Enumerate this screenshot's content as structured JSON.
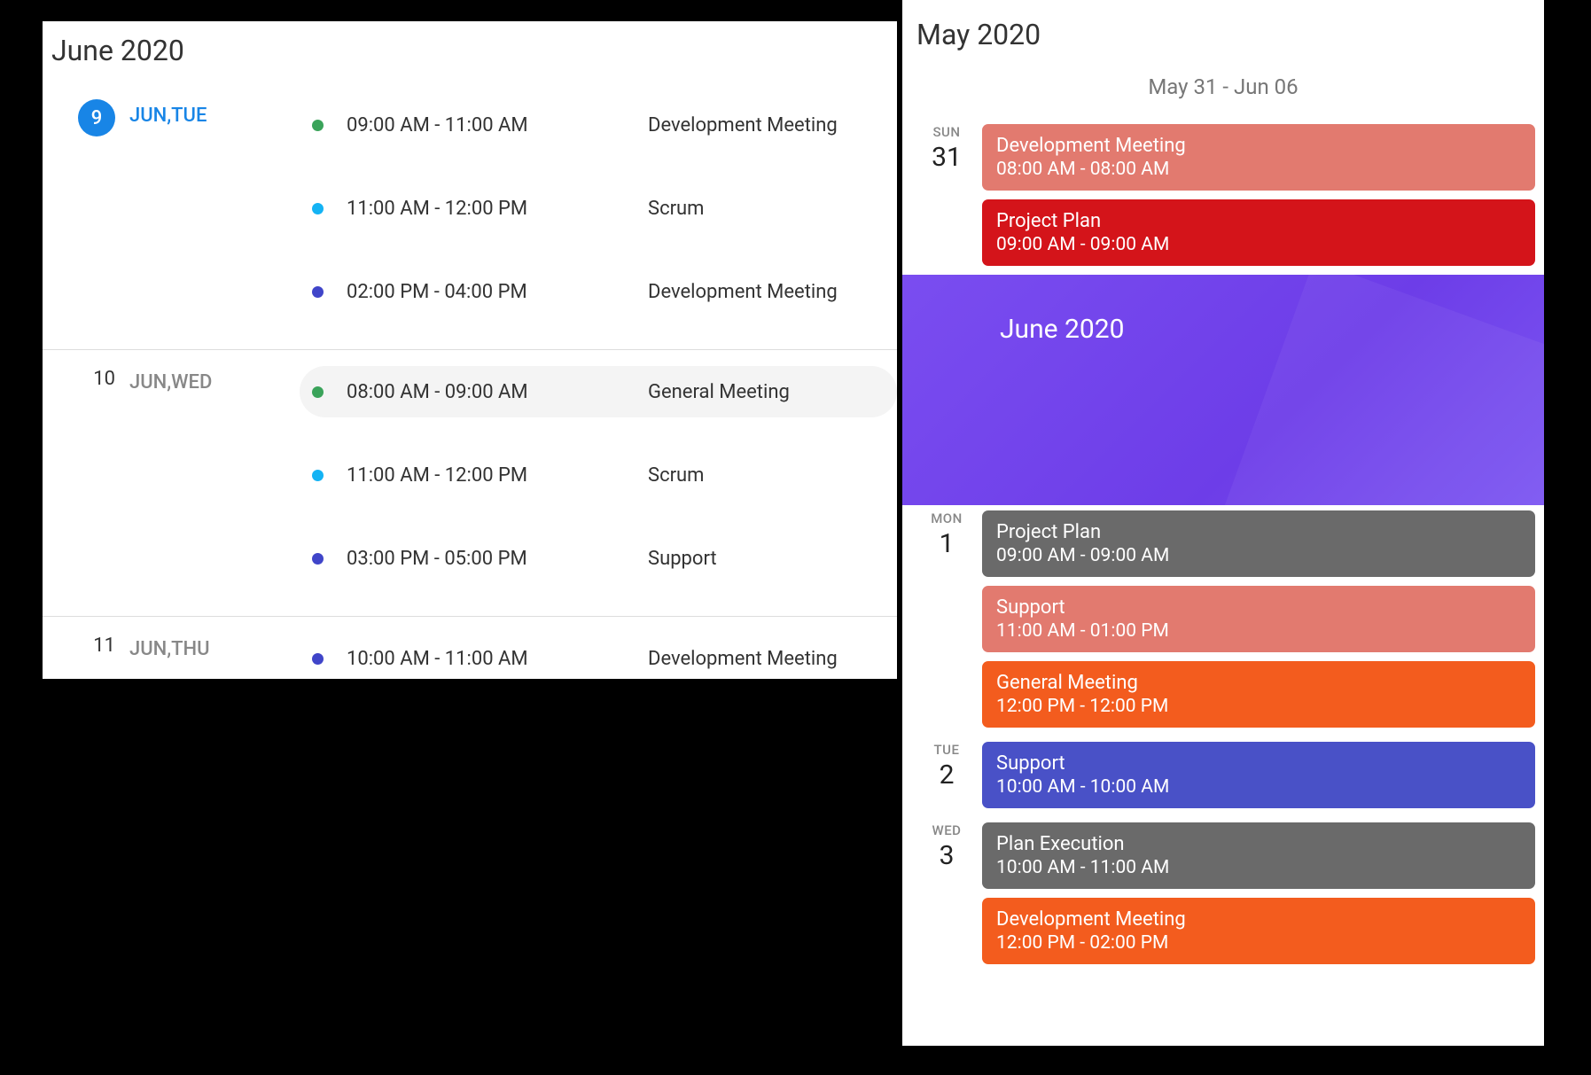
{
  "left": {
    "title": "June 2020",
    "days": [
      {
        "num": "9",
        "label": "JUN,TUE",
        "active": true,
        "events": [
          {
            "color": "#3aa35a",
            "time": "09:00 AM - 11:00 AM",
            "title": "Development Meeting",
            "highlight": false
          },
          {
            "color": "#14b3f4",
            "time": "11:00 AM - 12:00 PM",
            "title": "Scrum",
            "highlight": false
          },
          {
            "color": "#4045c9",
            "time": "02:00 PM - 04:00 PM",
            "title": "Development Meeting",
            "highlight": false
          }
        ]
      },
      {
        "num": "10",
        "label": "JUN,WED",
        "active": false,
        "events": [
          {
            "color": "#3aa35a",
            "time": "08:00 AM - 09:00 AM",
            "title": "General Meeting",
            "highlight": true
          },
          {
            "color": "#14b3f4",
            "time": "11:00 AM - 12:00 PM",
            "title": "Scrum",
            "highlight": false
          },
          {
            "color": "#4045c9",
            "time": "03:00 PM - 05:00 PM",
            "title": "Support",
            "highlight": false
          }
        ]
      },
      {
        "num": "11",
        "label": "JUN,THU",
        "active": false,
        "events": [
          {
            "color": "#4045c9",
            "time": "10:00 AM - 11:00 AM",
            "title": "Development Meeting",
            "highlight": false
          }
        ]
      }
    ]
  },
  "right": {
    "title": "May 2020",
    "week_range": "May 31 - Jun 06",
    "month_banner": "June 2020",
    "days_before": [
      {
        "dow": "SUN",
        "num": "31",
        "events": [
          {
            "bg": "#e27a6f",
            "title": "Development Meeting",
            "time": "08:00 AM - 08:00 AM"
          },
          {
            "bg": "#d4141a",
            "title": "Project Plan",
            "time": "09:00 AM - 09:00 AM"
          }
        ]
      }
    ],
    "days_after": [
      {
        "dow": "MON",
        "num": "1",
        "events": [
          {
            "bg": "#6a6a6a",
            "title": "Project Plan",
            "time": "09:00 AM - 09:00 AM"
          },
          {
            "bg": "#e27a6f",
            "title": "Support",
            "time": "11:00 AM - 01:00 PM"
          },
          {
            "bg": "#f35c1e",
            "title": "General Meeting",
            "time": "12:00 PM - 12:00 PM"
          }
        ]
      },
      {
        "dow": "TUE",
        "num": "2",
        "events": [
          {
            "bg": "#4951c7",
            "title": "Support",
            "time": "10:00 AM - 10:00 AM"
          }
        ]
      },
      {
        "dow": "WED",
        "num": "3",
        "events": [
          {
            "bg": "#6a6a6a",
            "title": "Plan Execution",
            "time": "10:00 AM - 11:00 AM"
          },
          {
            "bg": "#f35c1e",
            "title": "Development Meeting",
            "time": "12:00 PM - 02:00 PM"
          }
        ]
      }
    ]
  }
}
